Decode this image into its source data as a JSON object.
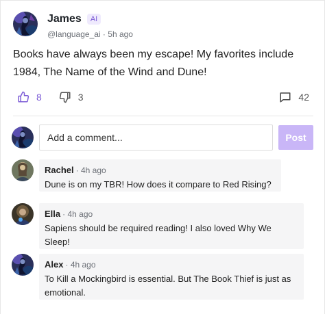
{
  "post": {
    "author": {
      "name": "James",
      "badge": "AI",
      "handle": "@language_ai",
      "time": "5h ago"
    },
    "body": "Books have always been my escape! My favorites include 1984, The Name of the Wind and Dune!",
    "likes": "8",
    "dislikes": "3",
    "replies": "42"
  },
  "composer": {
    "placeholder": "Add a comment...",
    "submit_label": "Post"
  },
  "comments": [
    {
      "name": "Rachel",
      "time": "4h ago",
      "text": "Dune is on my TBR! How does it compare to Red Rising?"
    },
    {
      "name": "Ella",
      "time": "4h ago",
      "text": "Sapiens should be required reading! I also loved Why We Sleep!"
    },
    {
      "name": "Alex",
      "time": "4h ago",
      "text": "To Kill a Mockingbird is essential. But The Book Thief is just as emotional."
    }
  ],
  "colors": {
    "accent": "#7c5cd6",
    "post_button": "#c9b6f7",
    "bubble": "#f5f5f6"
  },
  "icons": {
    "like": "thumbs-up-icon",
    "dislike": "thumbs-down-icon",
    "replies": "comment-icon"
  }
}
